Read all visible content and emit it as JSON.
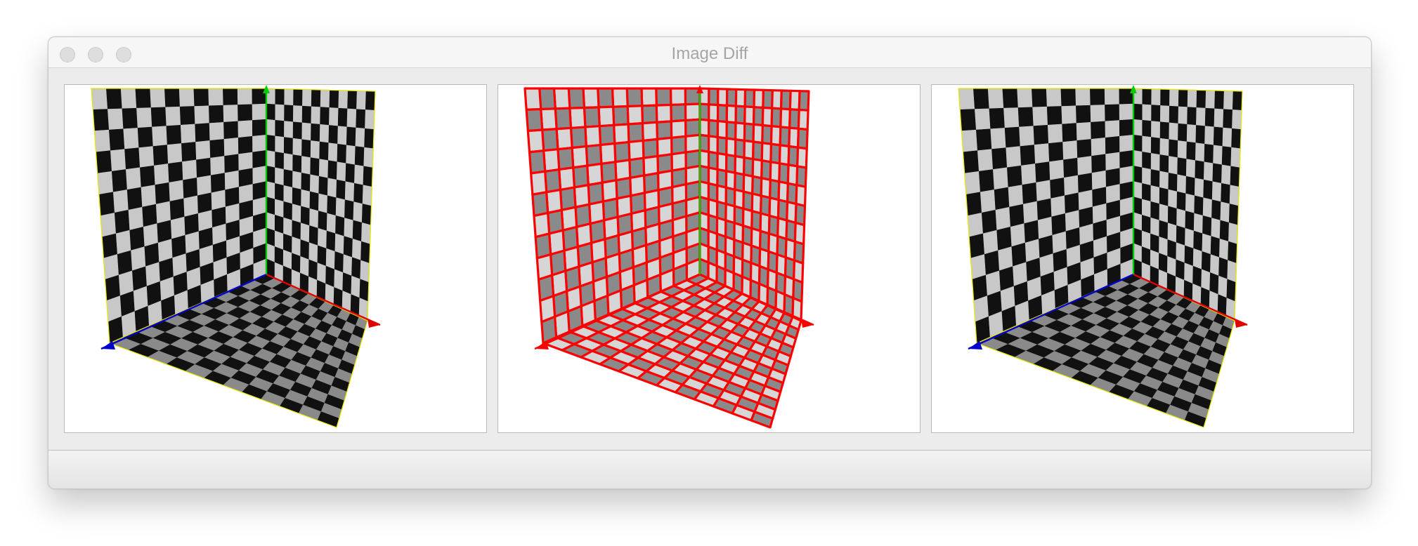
{
  "window": {
    "title": "Image Diff"
  },
  "panels": [
    {
      "id": "expected",
      "mode": "normal"
    },
    {
      "id": "difference",
      "mode": "diff"
    },
    {
      "id": "actual",
      "mode": "normal"
    }
  ],
  "colors": {
    "checker_dark": "#111111",
    "checker_light": "#c8c8c8",
    "checker_gray": "#8a8a8a",
    "diff_line": "#ff0000",
    "axis_x": "#e00000",
    "axis_y": "#00cc00",
    "axis_z": "#0000cc",
    "edge_highlight": "#e8e800"
  },
  "icons": {
    "close": "traffic-light-close",
    "minimize": "traffic-light-minimize",
    "zoom": "traffic-light-zoom"
  }
}
